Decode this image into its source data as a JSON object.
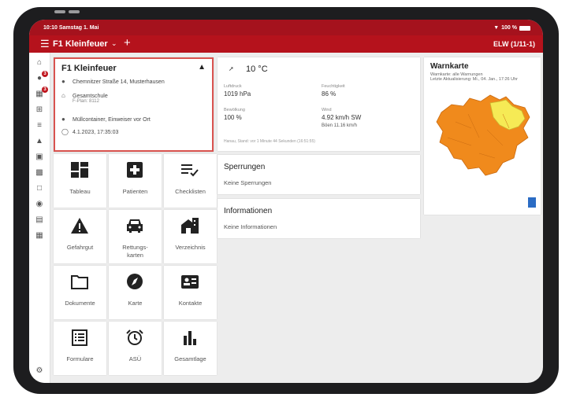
{
  "status_bar": {
    "time": "10:10  Samstag 1. Mai",
    "battery": "100 %"
  },
  "app_bar": {
    "title": "F1 Kleinfeuer",
    "right_label": "ELW (1/11-1)"
  },
  "sidebar": {
    "badges": [
      "3",
      "3"
    ]
  },
  "incident": {
    "title": "F1 Kleinfeuer",
    "address": "Chemnitzer Straße 14, Musterhausen",
    "object_name": "Gesamtschule",
    "object_sub": "F-Plan: 8112",
    "description": "Müllcontainer, Einweiser vor Ort",
    "datetime": "4.1.2023, 17:35:03"
  },
  "tiles": [
    {
      "label": "Tableau",
      "icon": "dashboard-icon"
    },
    {
      "label": "Patienten",
      "icon": "medical-plus-icon"
    },
    {
      "label": "Checklisten",
      "icon": "checklist-icon"
    },
    {
      "label": "Gefahrgut",
      "icon": "warning-icon"
    },
    {
      "label": "Rettungs-\nkarten",
      "icon": "car-icon"
    },
    {
      "label": "Verzeichnis",
      "icon": "building-icon"
    },
    {
      "label": "Dokumente",
      "icon": "folder-icon"
    },
    {
      "label": "Karte",
      "icon": "compass-icon"
    },
    {
      "label": "Kontakte",
      "icon": "contact-card-icon"
    },
    {
      "label": "Formulare",
      "icon": "form-icon"
    },
    {
      "label": "ASÜ",
      "icon": "alarm-clock-icon"
    },
    {
      "label": "Gesamtlage",
      "icon": "bar-chart-icon"
    }
  ],
  "weather": {
    "temperature": "10 °C",
    "pressure_label": "Luftdruck",
    "pressure": "1019 hPa",
    "humidity_label": "Feuchtigkeit",
    "humidity": "86 %",
    "clouds_label": "Bewölkung",
    "clouds": "100 %",
    "wind_label": "Wind",
    "wind": "4.92 km/h SW",
    "gusts": "Böen 11.16 km/h",
    "footer": "Hanau, Stand: vor 1 Minute 44 Sekunden (16:51:55)"
  },
  "closures": {
    "title": "Sperrungen",
    "text": "Keine Sperrungen"
  },
  "information": {
    "title": "Informationen",
    "text": "Keine Informationen"
  },
  "warnings": {
    "title": "Warnkarte",
    "line1": "Warnkarte: alle Warnungen",
    "line2": "Letzte Aktualisierung: Mi., 04. Jan., 17:26 Uhr"
  },
  "colors": {
    "brand": "#b5121c",
    "warn_orange": "#f08a1c",
    "warn_yellow": "#f6ea55"
  }
}
